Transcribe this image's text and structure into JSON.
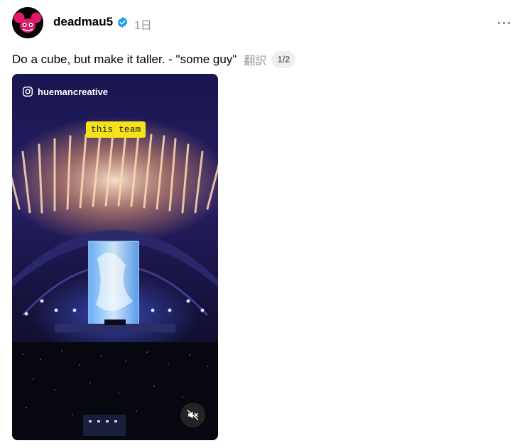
{
  "post": {
    "username": "deadmau5",
    "time": "1日",
    "caption": "Do a cube, but make it taller. - \"some guy\"",
    "translate_label": "翻訳",
    "pager": "1/2"
  },
  "media": {
    "instagram_handle": "huemancreative",
    "tag_text": "this team"
  },
  "icons": {
    "verified": "verified-badge-icon",
    "more": "more-options-icon",
    "instagram": "instagram-icon",
    "mute": "muted-speaker-icon"
  },
  "colors": {
    "verified": "#1d9bf0",
    "tag": "#f4e21c",
    "muted_text": "#999999"
  }
}
